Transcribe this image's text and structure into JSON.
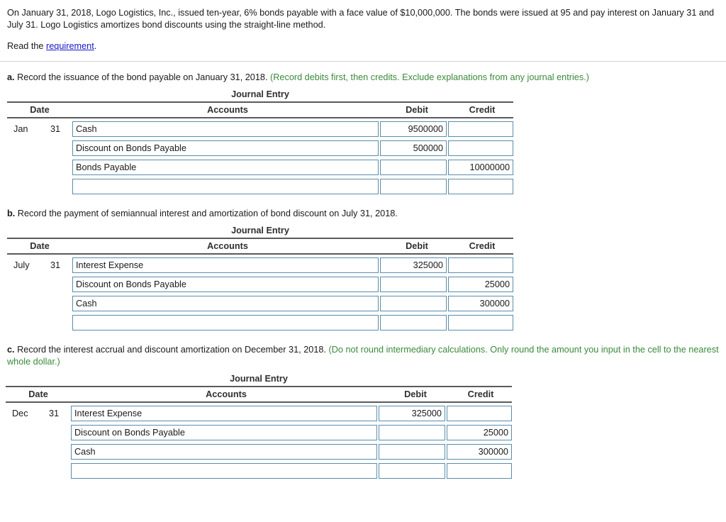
{
  "intro": {
    "paragraph": "On January 31, 2018, Logo Logistics, Inc., issued ten-year, 6% bonds payable with a face value of $10,000,000. The bonds were issued at 95 and pay interest on January 31 and July 31. Logo Logistics amortizes bond discounts using the straight-line method.",
    "read_prefix": "Read the ",
    "link_text": "requirement",
    "read_suffix": "."
  },
  "colors": {
    "link": "#1717c9",
    "hint": "#3a8a3a",
    "field_border": "#5b8cab",
    "rule": "#5a5a5a"
  },
  "table_headers": {
    "title": "Journal Entry",
    "date": "Date",
    "accounts": "Accounts",
    "debit": "Debit",
    "credit": "Credit"
  },
  "sections": [
    {
      "label": "a.",
      "prompt": " Record the issuance of the bond payable on January 31, 2018. ",
      "hint": "(Record debits first, then credits. Exclude explanations from any journal entries.)",
      "rows": [
        {
          "month": "Jan",
          "day": "31",
          "account": "Cash",
          "debit": "9500000",
          "credit": ""
        },
        {
          "month": "",
          "day": "",
          "account": "Discount on Bonds Payable",
          "debit": "500000",
          "credit": ""
        },
        {
          "month": "",
          "day": "",
          "account": "Bonds Payable",
          "debit": "",
          "credit": "10000000"
        },
        {
          "month": "",
          "day": "",
          "account": "",
          "debit": "",
          "credit": ""
        }
      ]
    },
    {
      "label": "b.",
      "prompt": " Record the payment of semiannual interest and amortization of bond discount on July 31, 2018.",
      "hint": "",
      "rows": [
        {
          "month": "July",
          "day": "31",
          "account": "Interest Expense",
          "debit": "325000",
          "credit": ""
        },
        {
          "month": "",
          "day": "",
          "account": "Discount on Bonds Payable",
          "debit": "",
          "credit": "25000"
        },
        {
          "month": "",
          "day": "",
          "account": "Cash",
          "debit": "",
          "credit": "300000"
        },
        {
          "month": "",
          "day": "",
          "account": "",
          "debit": "",
          "credit": ""
        }
      ]
    },
    {
      "label": "c.",
      "prompt": " Record the interest accrual and discount amortization on December 31, 2018. ",
      "hint": "(Do not round intermediary calculations. Only round the amount you input in the cell to the nearest whole dollar.)",
      "rows": [
        {
          "month": "Dec",
          "day": "31",
          "account": "Interest Expense",
          "debit": "325000",
          "credit": ""
        },
        {
          "month": "",
          "day": "",
          "account": "Discount on Bonds Payable",
          "debit": "",
          "credit": "25000"
        },
        {
          "month": "",
          "day": "",
          "account": "Cash",
          "debit": "",
          "credit": "300000"
        },
        {
          "month": "",
          "day": "",
          "account": "",
          "debit": "",
          "credit": ""
        }
      ]
    }
  ]
}
